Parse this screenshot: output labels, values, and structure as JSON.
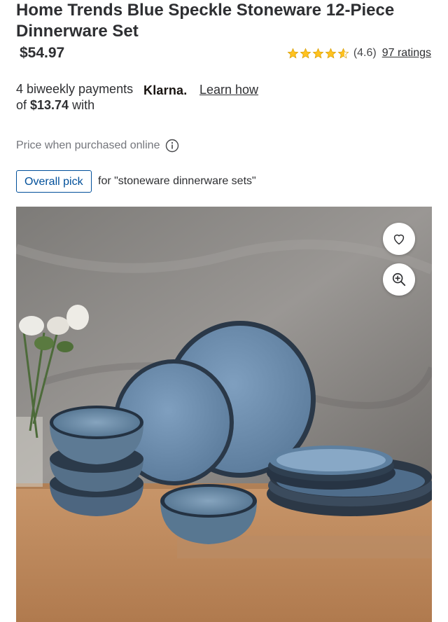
{
  "product": {
    "title": "Home Trends Blue Speckle Stoneware 12-Piece Dinnerware Set",
    "price": "$54.97",
    "rating_value": "(4.6)",
    "rating_stars": 4.6,
    "ratings_count": "97 ratings"
  },
  "klarna": {
    "line_prefix": "4 biweekly payments of ",
    "amount": "$13.74",
    "line_suffix": " with",
    "logo_text": "Klarna.",
    "learn_link": "Learn how"
  },
  "price_note": "Price when purchased online",
  "badge": {
    "label": "Overall pick",
    "context": "for \"stoneware dinnerware sets\""
  },
  "colors": {
    "star": "#ffc220",
    "badge_blue": "#004f9a",
    "text": "#2e2f32",
    "muted": "#74767c"
  },
  "icons": {
    "favorite": "heart-icon",
    "zoom": "zoom-in-icon",
    "info": "info-icon",
    "star": "star-icon"
  }
}
